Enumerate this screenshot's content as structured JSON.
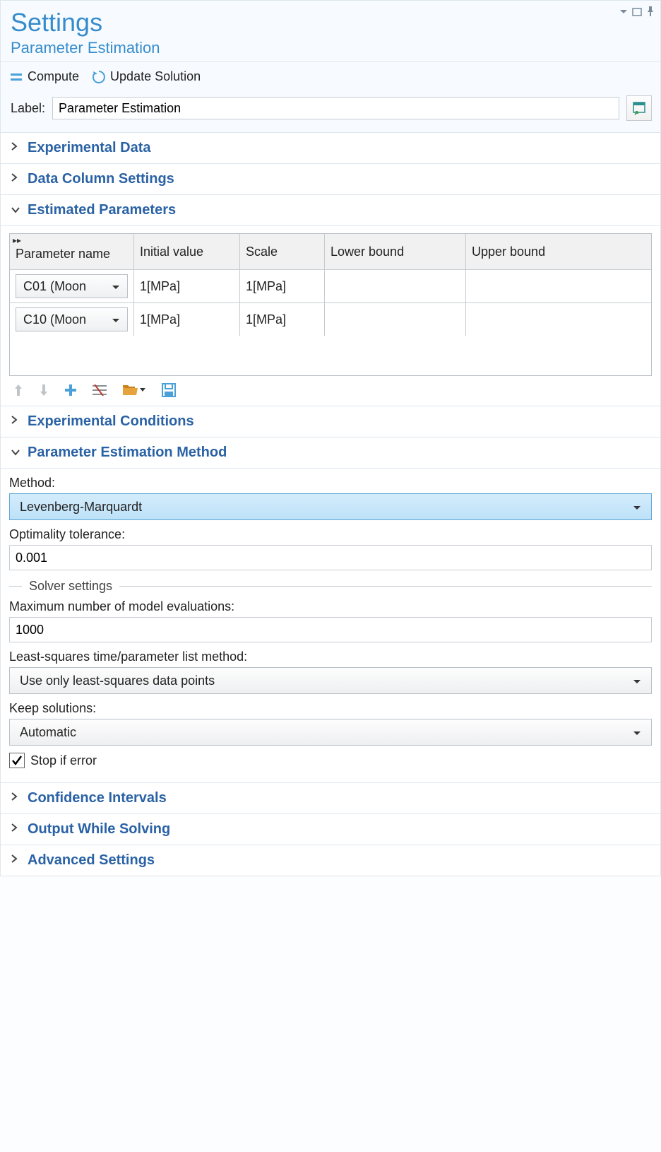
{
  "header": {
    "title": "Settings",
    "subtitle": "Parameter Estimation"
  },
  "toolbar": {
    "compute_label": "Compute",
    "update_label": "Update Solution"
  },
  "label_row": {
    "caption": "Label:",
    "value": "Parameter Estimation"
  },
  "sections": {
    "experimental_data": "Experimental Data",
    "data_column_settings": "Data Column Settings",
    "estimated_parameters": "Estimated Parameters",
    "experimental_conditions": "Experimental Conditions",
    "method": "Parameter Estimation Method",
    "confidence_intervals": "Confidence Intervals",
    "output_while_solving": "Output While Solving",
    "advanced_settings": "Advanced Settings"
  },
  "param_table": {
    "columns": [
      "Parameter name",
      "Initial value",
      "Scale",
      "Lower bound",
      "Upper bound"
    ],
    "rows": [
      {
        "name": "C01 (Moon",
        "initial": "1[MPa]",
        "scale": "1[MPa]",
        "lower": "",
        "upper": ""
      },
      {
        "name": "C10 (Moon",
        "initial": "1[MPa]",
        "scale": "1[MPa]",
        "lower": "",
        "upper": ""
      }
    ]
  },
  "method_section": {
    "method_label": "Method:",
    "method_value": "Levenberg-Marquardt",
    "opt_tol_label": "Optimality tolerance:",
    "opt_tol_value": "0.001",
    "solver_legend": "Solver settings",
    "max_eval_label": "Maximum number of model evaluations:",
    "max_eval_value": "1000",
    "ls_method_label": "Least-squares time/parameter list method:",
    "ls_method_value": "Use only least-squares data points",
    "keep_sol_label": "Keep solutions:",
    "keep_sol_value": "Automatic",
    "stop_if_error_label": "Stop if error"
  }
}
